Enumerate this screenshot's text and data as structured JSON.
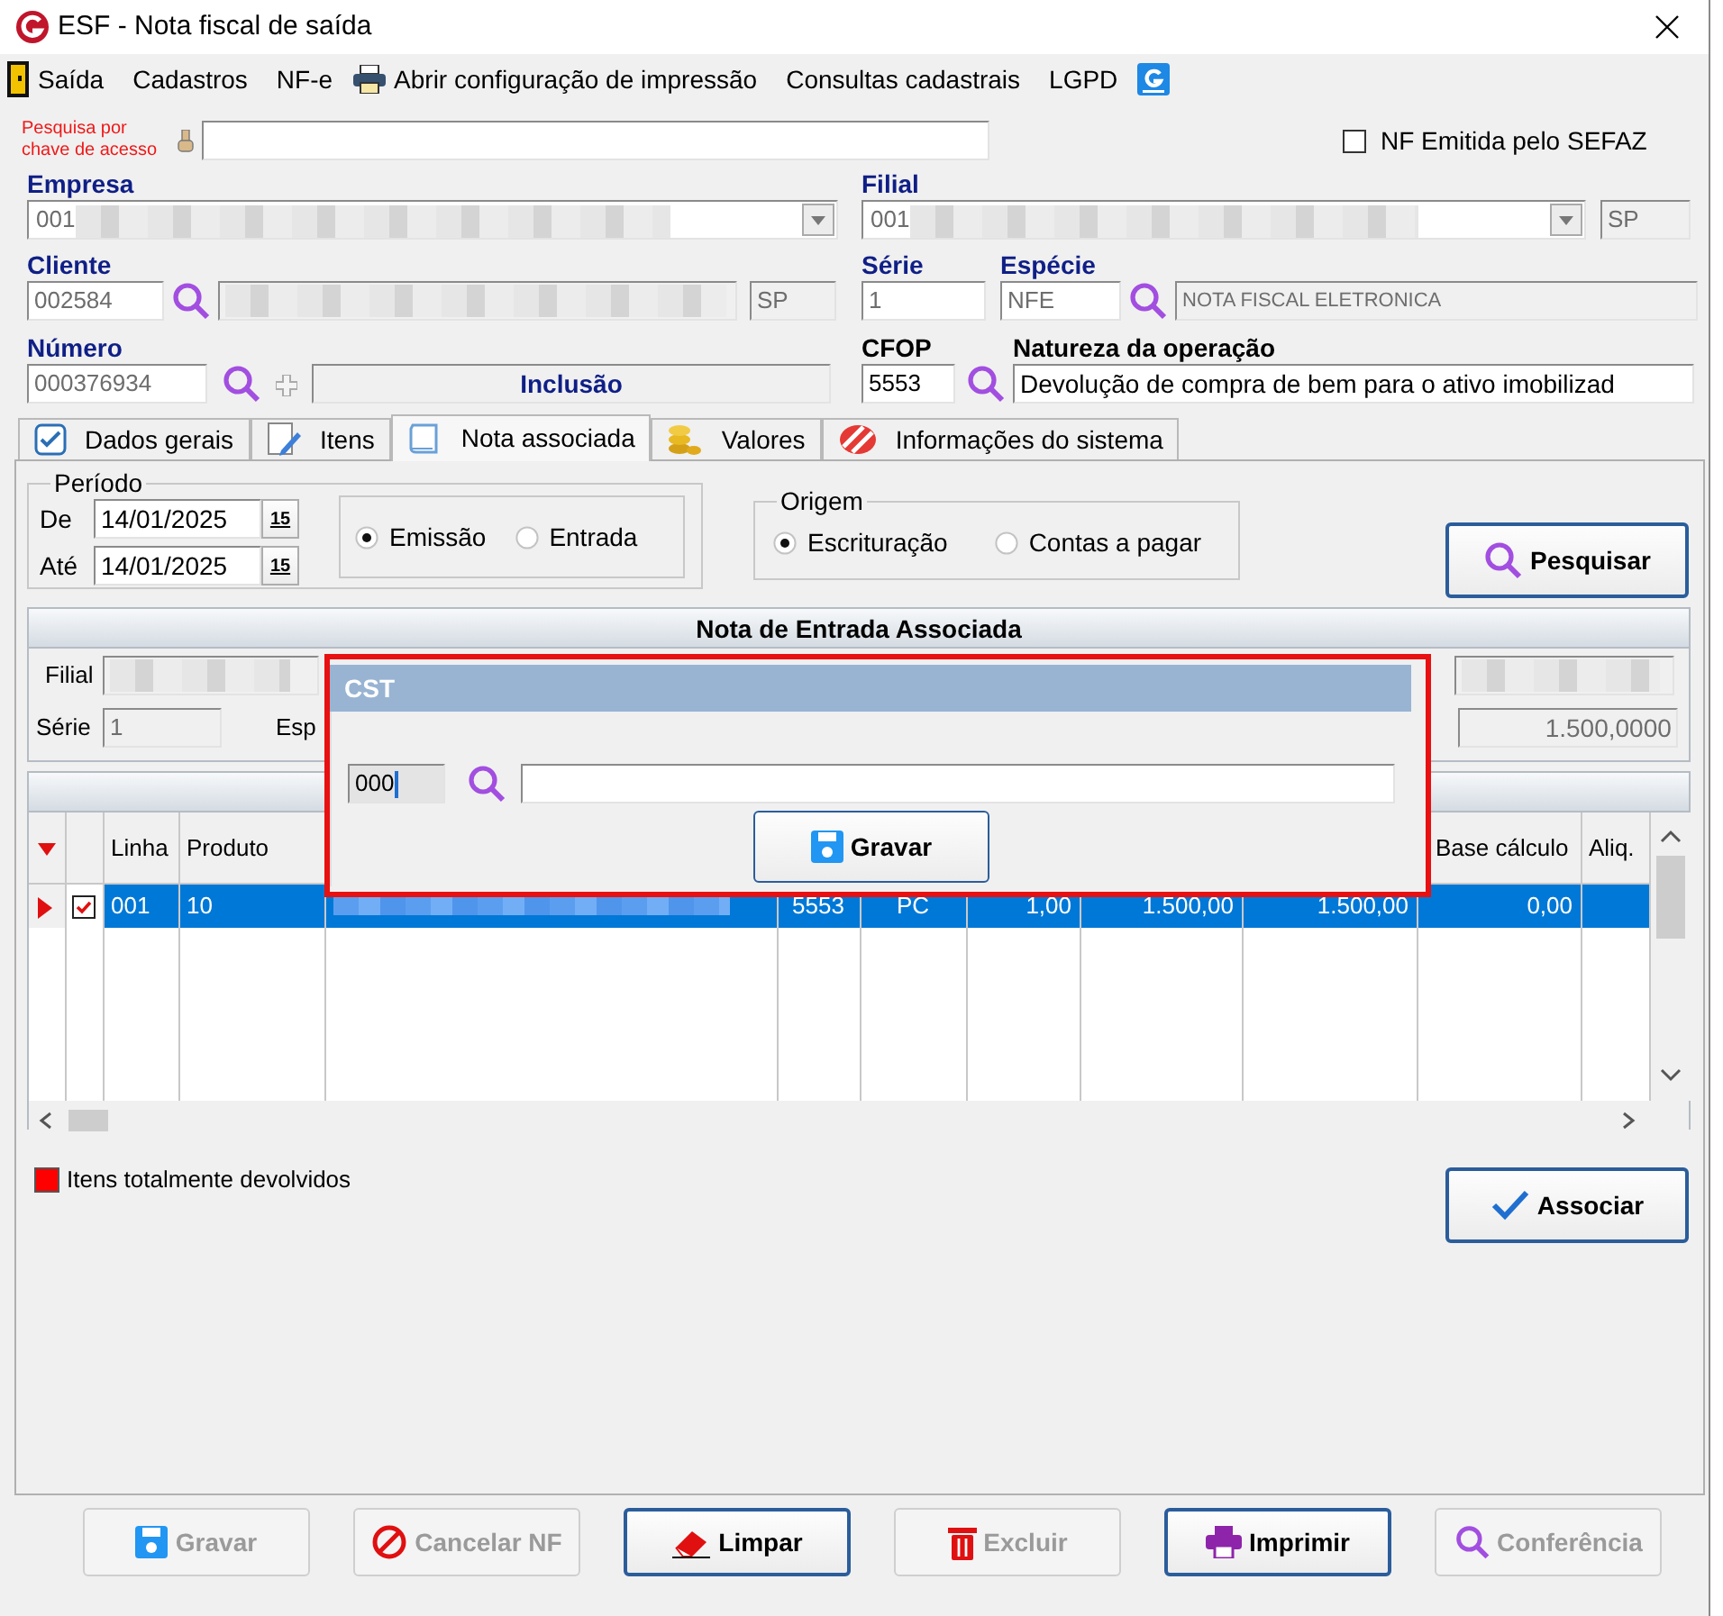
{
  "window": {
    "title": "ESF - Nota fiscal de saída"
  },
  "menu": [
    "Saída",
    "Cadastros",
    "NF-e",
    "Abrir configuração de impressão",
    "Consultas cadastrais",
    "LGPD"
  ],
  "access_key_search": {
    "label": "Pesquisa por chave de acesso"
  },
  "sefaz": {
    "label": "NF Emitida pelo SEFAZ",
    "checked": false
  },
  "empresa": {
    "label": "Empresa",
    "value": "001"
  },
  "filial": {
    "label": "Filial",
    "value": "001",
    "uf": "SP"
  },
  "cliente": {
    "label": "Cliente",
    "code": "002584",
    "uf": "SP"
  },
  "serie": {
    "label": "Série",
    "value": "1"
  },
  "especie": {
    "label": "Espécie",
    "code": "NFE",
    "description": "NOTA FISCAL ELETRONICA"
  },
  "numero": {
    "label": "Número",
    "value": "000376934",
    "mode": "Inclusão"
  },
  "cfop": {
    "label": "CFOP",
    "value": "5553"
  },
  "natureza": {
    "label": "Natureza da operação",
    "value": "Devolução de compra de bem para o ativo imobilizad"
  },
  "tabs": [
    {
      "label": "Dados gerais",
      "selected": false
    },
    {
      "label": "Itens",
      "selected": false
    },
    {
      "label": "Nota associada",
      "selected": true
    },
    {
      "label": "Valores",
      "selected": false
    },
    {
      "label": "Informações do sistema",
      "selected": false
    }
  ],
  "periodo": {
    "label": "Período",
    "from_label": "De",
    "from": "14/01/2025",
    "from_calendar": "15",
    "to_label": "Até",
    "to": "14/01/2025",
    "to_calendar": "15",
    "options": [
      {
        "label": "Emissão",
        "selected": true
      },
      {
        "label": "Entrada",
        "selected": false
      }
    ]
  },
  "origem": {
    "label": "Origem",
    "options": [
      {
        "label": "Escrituração",
        "selected": true
      },
      {
        "label": "Contas a pagar",
        "selected": false
      }
    ]
  },
  "search_button": "Pesquisar",
  "nota_entrada": {
    "title": "Nota de Entrada Associada",
    "filial_label": "Filial",
    "serie_label": "Série",
    "serie": "1",
    "especie_label": "Esp",
    "valor": "1.500,0000"
  },
  "grid": {
    "columns": [
      "",
      "",
      "Linha",
      "Produto",
      "",
      "",
      "",
      "",
      "",
      "",
      "Base cálculo",
      "Aliq."
    ],
    "rows": [
      {
        "selected": true,
        "checked": true,
        "cells": [
          "",
          "",
          "001",
          "10",
          "",
          "5553",
          "PC",
          "1,00",
          "1.500,00",
          "1.500,00",
          "0,00",
          ""
        ]
      }
    ]
  },
  "legend": {
    "label": "Itens totalmente devolvidos",
    "color": "#ff0000"
  },
  "associar_button": "Associar",
  "footer_buttons": [
    {
      "label": "Gravar",
      "disabled": true
    },
    {
      "label": "Cancelar NF",
      "disabled": true
    },
    {
      "label": "Limpar",
      "disabled": false
    },
    {
      "label": "Excluir",
      "disabled": true
    },
    {
      "label": "Imprimir",
      "disabled": false
    },
    {
      "label": "Conferência",
      "disabled": true
    }
  ],
  "dialog": {
    "title": "CST",
    "code": "000",
    "button": "Gravar"
  }
}
